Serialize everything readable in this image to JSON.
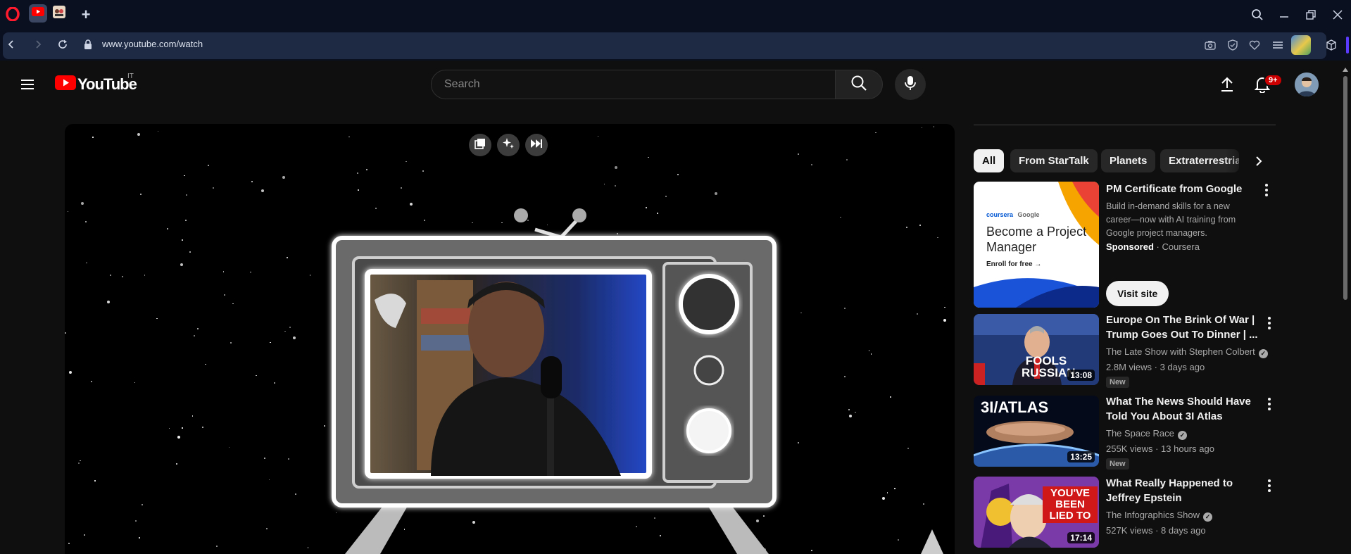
{
  "browser": {
    "url": "www.youtube.com/watch"
  },
  "youtube": {
    "logo_text": "YouTube",
    "country_code": "IT",
    "search_placeholder": "Search",
    "notification_count": "9+"
  },
  "video_overlay_buttons": [
    "miniplayer",
    "ai-enhance",
    "skip-forward"
  ],
  "chips": [
    {
      "label": "All",
      "active": true
    },
    {
      "label": "From StarTalk",
      "active": false
    },
    {
      "label": "Planets",
      "active": false
    },
    {
      "label": "Extraterrestrial",
      "active": false
    }
  ],
  "ad": {
    "title": "PM Certificate from Google",
    "description": "Build in-demand skills for a new career—now with AI training from Google project managers.",
    "sponsored_label": "Sponsored",
    "advertiser": "Coursera",
    "cta": "Visit site",
    "thumb_brand_1": "coursera",
    "thumb_brand_2": "Google",
    "thumb_headline": "Become a Project Manager",
    "thumb_cta": "Enroll for free →"
  },
  "videos": [
    {
      "title": "Europe On The Brink Of War | Trump Goes Out To Dinner | ...",
      "channel": "The Late Show with Stephen Colbert",
      "verified": true,
      "views": "2.8M views",
      "age": "3 days ago",
      "badge": "New",
      "duration": "13:08",
      "thumb_text": "FOOLS RUSSIAN"
    },
    {
      "title": "What The News Should Have Told You About 3I Atlas",
      "channel": "The Space Race",
      "verified": true,
      "views": "255K views",
      "age": "13 hours ago",
      "badge": "New",
      "duration": "13:25",
      "thumb_text": "3I/ATLAS"
    },
    {
      "title": "What Really Happened to Jeffrey Epstein",
      "channel": "The Infographics Show",
      "verified": true,
      "views": "527K views",
      "age": "8 days ago",
      "badge": "",
      "duration": "17:14",
      "thumb_text": "YOU'VE BEEN LIED TO"
    }
  ],
  "colors": {
    "brand_red": "#ff0000",
    "background": "#0f0f0f",
    "browser_chrome": "#0b1020",
    "chip_bg": "#272727"
  }
}
